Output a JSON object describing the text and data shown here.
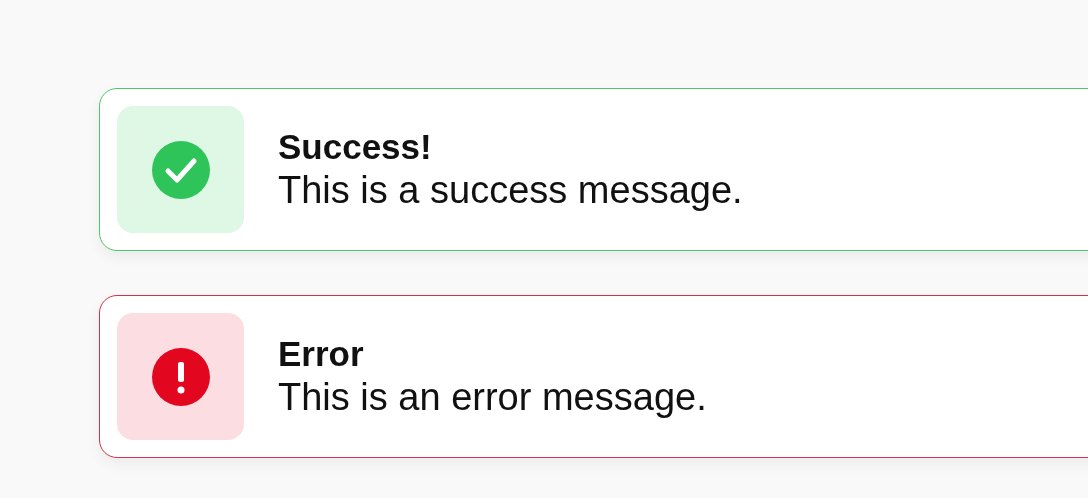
{
  "toasts": [
    {
      "kind": "success",
      "title": "Success!",
      "message": "This is a success message."
    },
    {
      "kind": "error",
      "title": "Error",
      "message": "This is an error message."
    }
  ]
}
